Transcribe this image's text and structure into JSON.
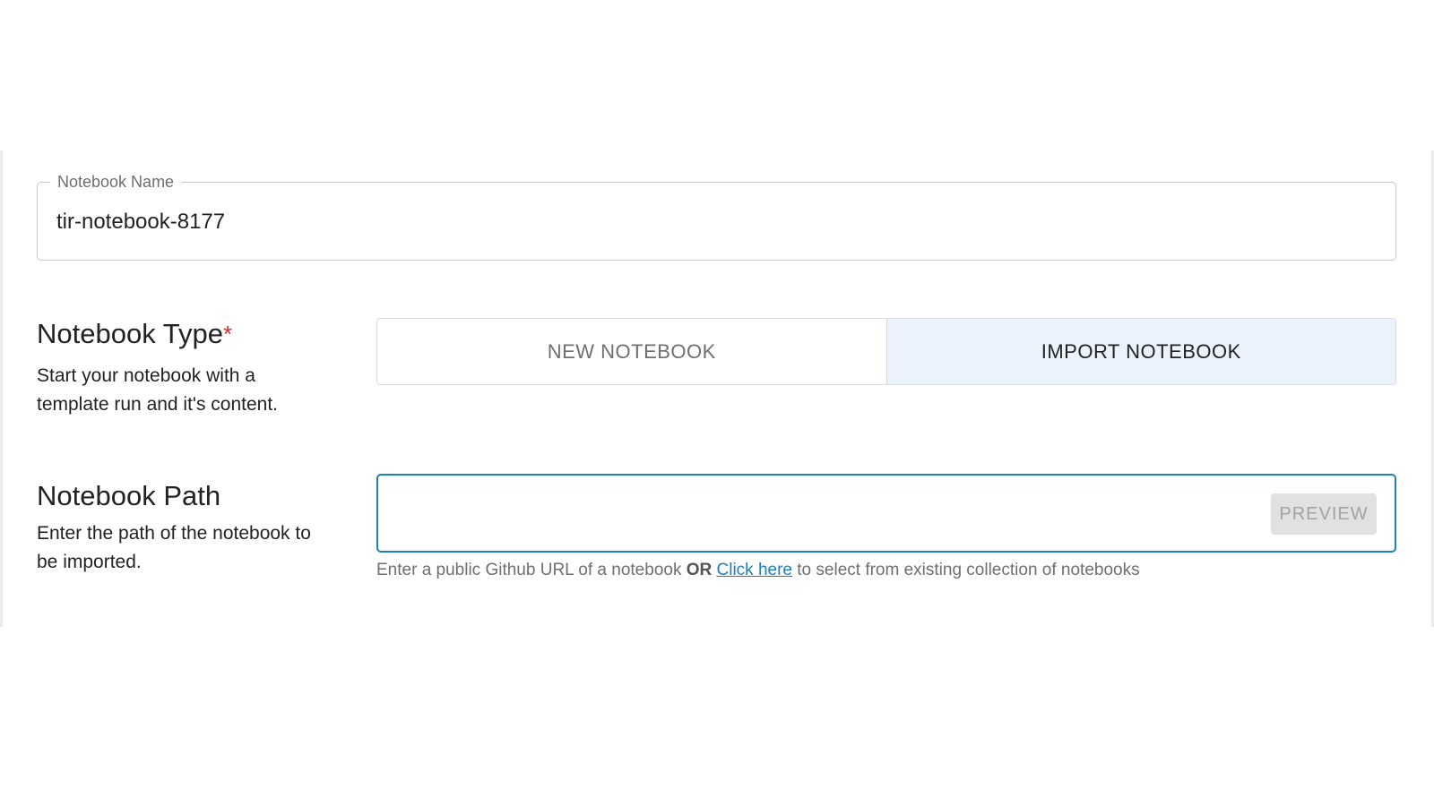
{
  "notebook_name": {
    "label": "Notebook Name",
    "value": "tir-notebook-8177"
  },
  "notebook_type": {
    "title": "Notebook Type",
    "required_marker": "*",
    "description": "Start your notebook with a template run and it's content.",
    "options": [
      {
        "label": "NEW NOTEBOOK",
        "selected": false
      },
      {
        "label": "IMPORT NOTEBOOK",
        "selected": true
      }
    ]
  },
  "notebook_path": {
    "title": "Notebook Path",
    "description": "Enter the path of the notebook to be imported.",
    "value": "",
    "preview_label": "PREVIEW",
    "helper": {
      "prefix": "Enter a public Github URL of a notebook",
      "or": "OR",
      "link": "Click here",
      "suffix": "to select from existing collection of notebooks"
    }
  },
  "colors": {
    "accent": "#1e7fc0",
    "selected_bg": "#eaf3fd",
    "required": "#d32f2f"
  }
}
